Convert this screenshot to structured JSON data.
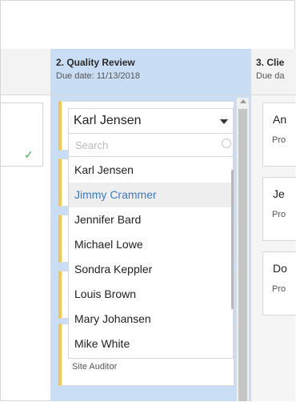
{
  "columns": [
    {
      "title": "",
      "due": ""
    },
    {
      "title": "2. Quality Review",
      "due": "Due date: 11/13/2018"
    },
    {
      "title": "3. Clie",
      "due": "Due da"
    }
  ],
  "assignee_select": {
    "selected": "Karl Jensen",
    "search_placeholder": "Search"
  },
  "assignee_options": [
    {
      "label": "Karl Jensen",
      "highlighted": false
    },
    {
      "label": "Jimmy Crammer",
      "highlighted": true
    },
    {
      "label": "Jennifer Bard",
      "highlighted": false
    },
    {
      "label": "Michael Lowe",
      "highlighted": false
    },
    {
      "label": "Sondra Keppler",
      "highlighted": false
    },
    {
      "label": "Louis Brown",
      "highlighted": false
    },
    {
      "label": "Mary Johansen",
      "highlighted": false
    },
    {
      "label": "Mike White",
      "highlighted": false
    }
  ],
  "card_role": "Site Auditor",
  "right_cards": [
    {
      "title": "An",
      "subtitle": "Pro"
    },
    {
      "title": "Je",
      "subtitle": "Pro"
    },
    {
      "title": "Do",
      "subtitle": "Pro"
    }
  ],
  "colors": {
    "accent": "#3d7bc4",
    "column_active": "#c9ddf4",
    "card_stripe": "#f3c84a",
    "check": "#4caf50"
  },
  "icons": [
    "check-icon",
    "caret-down-icon",
    "search-icon",
    "scroll-up-icon"
  ]
}
